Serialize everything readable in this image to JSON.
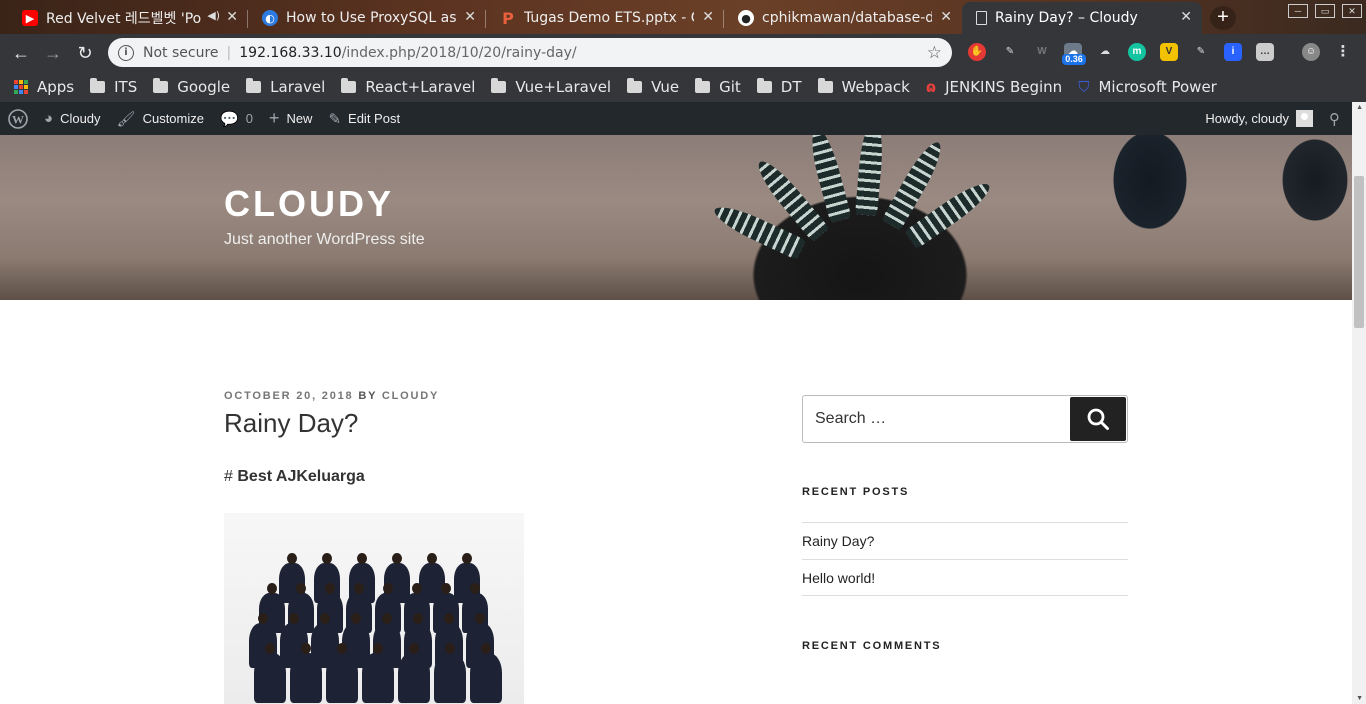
{
  "tabs": [
    {
      "title": "Red Velvet 레드벨벳 'Po",
      "icon": "youtube-icon",
      "color": "#ff0000"
    },
    {
      "title": "How to Use ProxySQL as a",
      "icon": "proxysql-icon",
      "color": "#3b82f6"
    },
    {
      "title": "Tugas Demo ETS.pptx - G",
      "icon": "powerpoint-icon",
      "color": "#e8603c"
    },
    {
      "title": "cphikmawan/database-dk",
      "icon": "github-icon",
      "color": "#ffffff"
    },
    {
      "title": "Rainy Day? – Cloudy",
      "icon": "page-icon",
      "color": "#dddddd"
    }
  ],
  "address": {
    "security": "Not secure",
    "host": "192.168.33.10",
    "path": "/index.php/2018/10/20/rainy-day/"
  },
  "extensions": {
    "badge": "0.36"
  },
  "bookmarks": [
    {
      "label": "Apps",
      "type": "apps"
    },
    {
      "label": "ITS",
      "type": "folder"
    },
    {
      "label": "Google",
      "type": "folder"
    },
    {
      "label": "Laravel",
      "type": "folder"
    },
    {
      "label": "React+Laravel",
      "type": "folder"
    },
    {
      "label": "Vue+Laravel",
      "type": "folder"
    },
    {
      "label": "Vue",
      "type": "folder"
    },
    {
      "label": "Git",
      "type": "folder"
    },
    {
      "label": "DT",
      "type": "folder"
    },
    {
      "label": "Webpack",
      "type": "folder"
    },
    {
      "label": "JENKINS Beginn",
      "type": "jenkins"
    },
    {
      "label": "Microsoft Power",
      "type": "power"
    }
  ],
  "adminbar": {
    "site": "Cloudy",
    "customize": "Customize",
    "comments": "0",
    "new": "New",
    "edit": "Edit Post",
    "howdy": "Howdy, cloudy"
  },
  "site": {
    "title": "CLOUDY",
    "tagline": "Just another WordPress site"
  },
  "post": {
    "date": "OCTOBER 20, 2018",
    "by": "BY",
    "author": "CLOUDY",
    "title": "Rainy Day?",
    "hash": "#",
    "hashtext": "Best AJKeluarga"
  },
  "sidebar": {
    "search_placeholder": "Search …",
    "recent_posts_title": "RECENT POSTS",
    "recent_posts": [
      "Rainy Day?",
      "Hello world!"
    ],
    "recent_comments_title": "RECENT COMMENTS"
  }
}
